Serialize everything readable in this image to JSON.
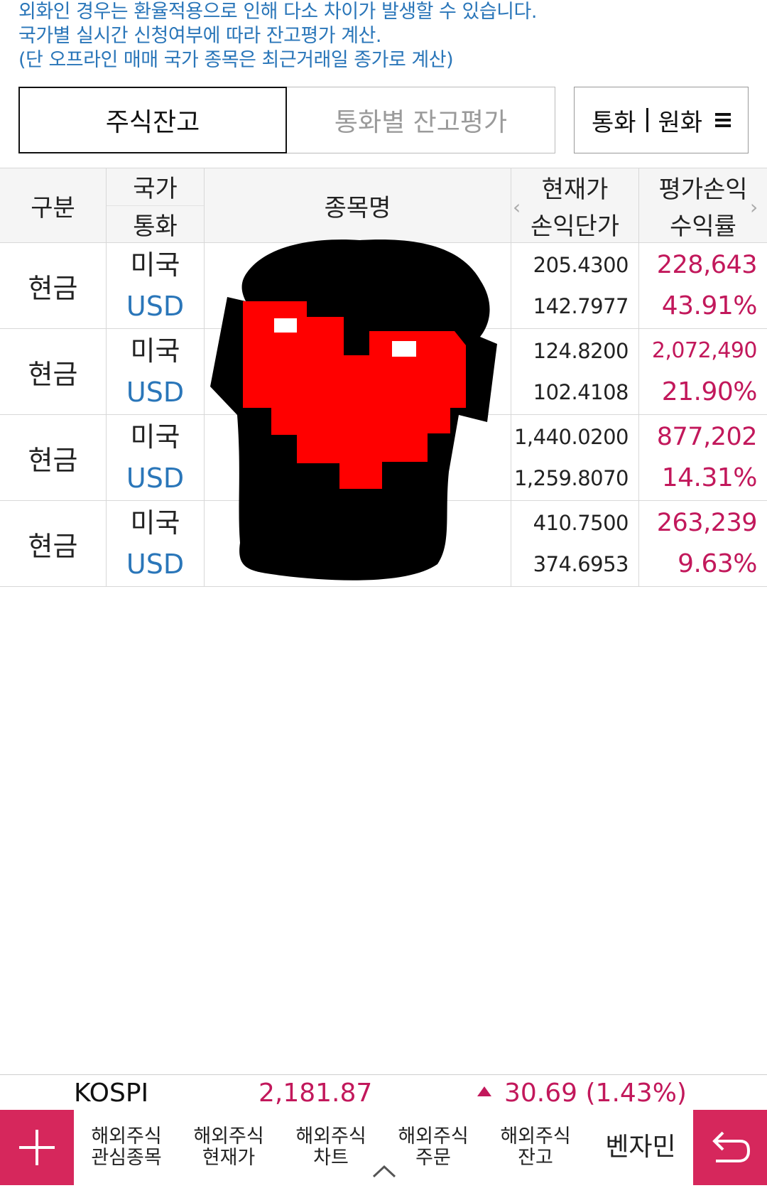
{
  "notice": {
    "line1": "외화인 경우는 환율적용으로 인해 다소 차이가 발생할 수 있습니다.",
    "line2": "국가별 실시간 신청여부에 따라 잔고평가 계산.",
    "line3": "(단 오프라인 매매 국가 종목은 최근거래일 종가로 계산)"
  },
  "tabs": {
    "stock_balance": "주식잔고",
    "currency_valuation": "통화별 잔고평가"
  },
  "currency_toggle": {
    "left": "통화",
    "right": "원화",
    "icon": "hamburger-menu-icon"
  },
  "table": {
    "headers": {
      "category": "구분",
      "country": "국가",
      "currency": "통화",
      "stock_name": "종목명",
      "current_price": "현재가",
      "avg_price": "손익단가",
      "profit_loss": "평가손익",
      "return_rate": "수익률"
    },
    "rows": [
      {
        "category": "현금",
        "country": "미국",
        "currency": "USD",
        "current_price": "205.4300",
        "avg_price": "142.7977",
        "profit_loss": "228,643",
        "return_rate": "43.91%"
      },
      {
        "category": "현금",
        "country": "미국",
        "currency": "USD",
        "current_price": "124.8200",
        "avg_price": "102.4108",
        "profit_loss": "2,072,490",
        "return_rate": "21.90%"
      },
      {
        "category": "현금",
        "country": "미국",
        "currency": "USD",
        "current_price": "1,440.0200",
        "avg_price": "1,259.8070",
        "profit_loss": "877,202",
        "return_rate": "14.31%"
      },
      {
        "category": "현금",
        "country": "미국",
        "currency": "USD",
        "current_price": "410.7500",
        "avg_price": "374.6953",
        "profit_loss": "263,239",
        "return_rate": "9.63%"
      }
    ]
  },
  "ticker": {
    "index": "KOSPI",
    "value": "2,181.87",
    "change": "30.69 (1.43%)"
  },
  "bottom_nav": {
    "items": [
      {
        "line1": "해외주식",
        "line2": "관심종목"
      },
      {
        "line1": "해외주식",
        "line2": "현재가"
      },
      {
        "line1": "해외주식",
        "line2": "차트"
      },
      {
        "line1": "해외주식",
        "line2": "주문"
      },
      {
        "line1": "해외주식",
        "line2": "잔고"
      }
    ],
    "user_label": "벤자민"
  },
  "colors": {
    "accent": "#d6275c",
    "profit": "#c2185b",
    "info": "#2a76b9"
  }
}
